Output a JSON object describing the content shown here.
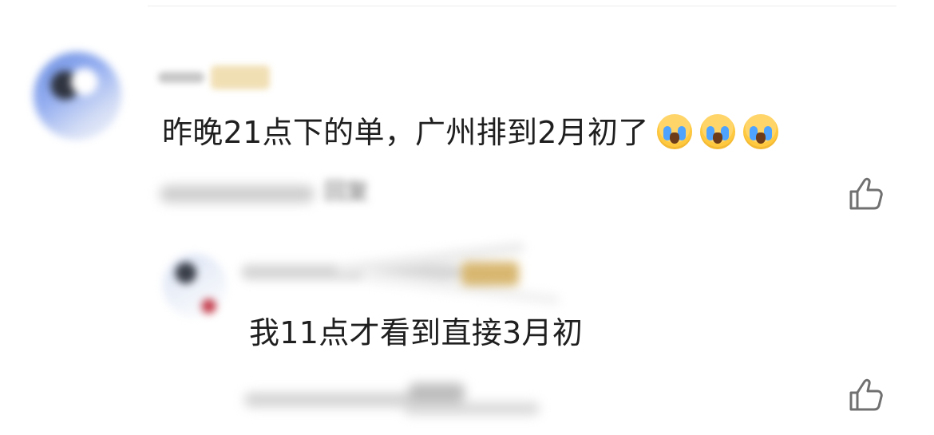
{
  "comment": {
    "text": "昨晚21点下的单，广州排到2月初了",
    "emojis": [
      "loudly-crying-face-icon",
      "loudly-crying-face-icon",
      "loudly-crying-face-icon"
    ],
    "like_icon": "thumb-up-icon"
  },
  "reply": {
    "text": "我11点才看到直接3月初",
    "like_icon": "thumb-up-icon"
  }
}
